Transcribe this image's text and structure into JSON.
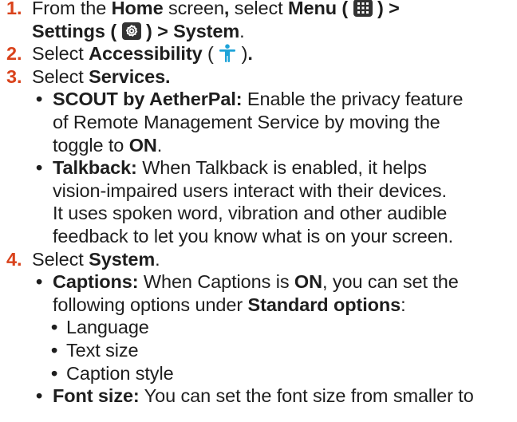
{
  "steps": [
    {
      "number": "1.",
      "line1": {
        "t1": "From the ",
        "home": "Home",
        "t2": " screen",
        "comma": ",",
        "t3": " select ",
        "menu": "Menu",
        "t4": " (",
        "t5": ") >"
      },
      "line2": {
        "settings": "Settings",
        "t1": " (",
        "t2": ") > ",
        "system": "System",
        "t3": "."
      },
      "icons": [
        "menu-grid-icon",
        "settings-gear-icon"
      ]
    },
    {
      "number": "2.",
      "t1": "Select ",
      "accessibility": "Accessibility",
      "t2": " (",
      "t3": ")",
      "t4": ".",
      "icon": "accessibility-icon"
    },
    {
      "number": "3.",
      "t1": "Select ",
      "services": "Services.",
      "bullets": [
        {
          "term": "SCOUT by AetherPal:",
          "lines": [
            " Enable the privacy feature",
            "of Remote Management Service by moving the",
            "toggle to "
          ],
          "on": "ON",
          "tail": "."
        },
        {
          "term": "Talkback:",
          "lines": [
            " When Talkback is enabled, it helps",
            "vision-impaired users interact with their devices.",
            "It uses spoken word, vibration and other audible",
            "feedback to let you know what is on your screen."
          ]
        }
      ]
    },
    {
      "number": "4.",
      "t1": "Select ",
      "system": "System",
      "t2": ".",
      "bullets": [
        {
          "term": "Captions:",
          "t1": " When Captions is ",
          "on": "ON",
          "t2": ", you can set the",
          "t3": "following options under ",
          "standard": "Standard options",
          "t4": ":",
          "options": [
            "Language",
            "Text size",
            "Caption style"
          ]
        },
        {
          "term": "Font size:",
          "t1": " You can set the font size from smaller to"
        }
      ]
    }
  ],
  "bullet_char": "•",
  "colors": {
    "step_number": "#d9421b",
    "text": "#1e1e1e",
    "icon_box": "#333333",
    "accessibility_icon": "#1ea3d8"
  }
}
